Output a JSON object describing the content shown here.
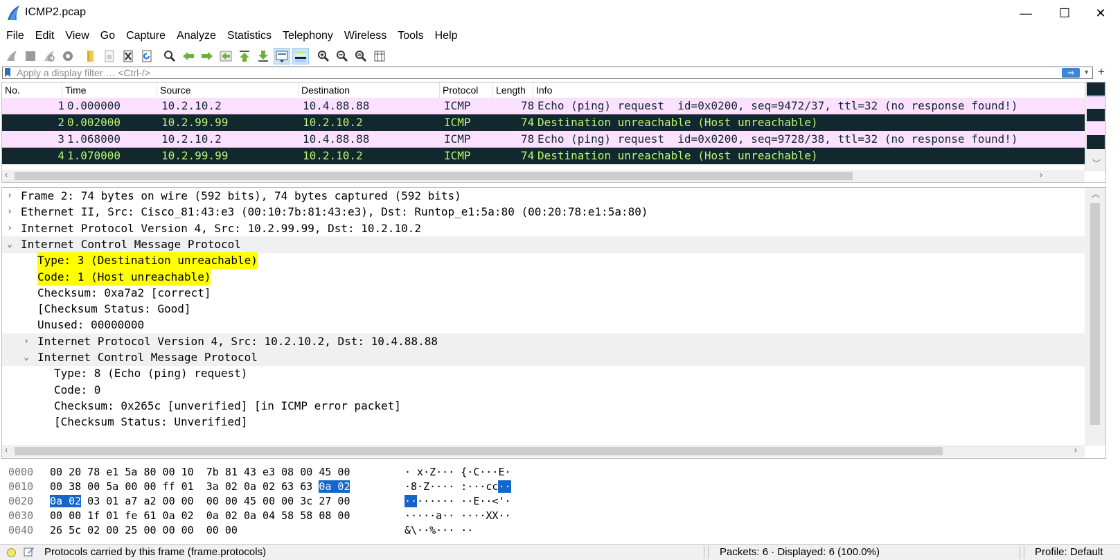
{
  "window": {
    "title": "ICMP2.pcap",
    "minimize": "—",
    "maximize": "☐",
    "close": "✕"
  },
  "menu": [
    "File",
    "Edit",
    "View",
    "Go",
    "Capture",
    "Analyze",
    "Statistics",
    "Telephony",
    "Wireless",
    "Tools",
    "Help"
  ],
  "toolbar": {
    "icons": [
      "shark-fin-start-icon",
      "stop-capture-icon",
      "restart-capture-icon",
      "capture-options-icon",
      "open-file-icon",
      "save-file-icon",
      "close-file-icon",
      "reload-file-icon",
      "find-packet-icon",
      "go-back-icon",
      "go-forward-icon",
      "go-to-packet-icon",
      "go-first-icon",
      "go-last-icon",
      "autoscroll-icon",
      "colorize-icon",
      "zoom-in-icon",
      "zoom-out-icon",
      "zoom-normal-icon",
      "resize-columns-icon"
    ]
  },
  "filter": {
    "placeholder": "Apply a display filter … <Ctrl-/>",
    "apply_label": "⇒",
    "add_label": "+"
  },
  "packet_list": {
    "columns": [
      "No.",
      "Time",
      "Source",
      "Destination",
      "Protocol",
      "Length",
      "Info"
    ],
    "rows": [
      {
        "no": "1",
        "time": "0.000000",
        "source": "10.2.10.2",
        "destination": "10.4.88.88",
        "protocol": "ICMP",
        "length": "78",
        "info": "Echo (ping) request  id=0x0200, seq=9472/37, ttl=32 (no response found!)",
        "kind": "req"
      },
      {
        "no": "2",
        "time": "0.002000",
        "source": "10.2.99.99",
        "destination": "10.2.10.2",
        "protocol": "ICMP",
        "length": "74",
        "info": "Destination unreachable (Host unreachable)",
        "kind": "err"
      },
      {
        "no": "3",
        "time": "1.068000",
        "source": "10.2.10.2",
        "destination": "10.4.88.88",
        "protocol": "ICMP",
        "length": "78",
        "info": "Echo (ping) request  id=0x0200, seq=9728/38, ttl=32 (no response found!)",
        "kind": "req"
      },
      {
        "no": "4",
        "time": "1.070000",
        "source": "10.2.99.99",
        "destination": "10.2.10.2",
        "protocol": "ICMP",
        "length": "74",
        "info": "Destination unreachable (Host unreachable)",
        "kind": "err"
      }
    ]
  },
  "details": {
    "lines": [
      {
        "indent": 0,
        "arrow": "›",
        "text": "Frame 2: 74 bytes on wire (592 bits), 74 bytes captured (592 bits)",
        "expanded": false,
        "highlight": false
      },
      {
        "indent": 0,
        "arrow": "›",
        "text": "Ethernet II, Src: Cisco_81:43:e3 (00:10:7b:81:43:e3), Dst: Runtop_e1:5a:80 (00:20:78:e1:5a:80)",
        "expanded": false,
        "highlight": false
      },
      {
        "indent": 0,
        "arrow": "›",
        "text": "Internet Protocol Version 4, Src: 10.2.99.99, Dst: 10.2.10.2",
        "expanded": false,
        "highlight": false
      },
      {
        "indent": 0,
        "arrow": "⌄",
        "text": "Internet Control Message Protocol",
        "expanded": true,
        "highlight": false
      },
      {
        "indent": 1,
        "arrow": "",
        "text": "Type: 3 (Destination unreachable)",
        "expanded": false,
        "highlight": true
      },
      {
        "indent": 1,
        "arrow": "",
        "text": "Code: 1 (Host unreachable)",
        "expanded": false,
        "highlight": true
      },
      {
        "indent": 1,
        "arrow": "",
        "text": "Checksum: 0xa7a2 [correct]",
        "expanded": false,
        "highlight": false
      },
      {
        "indent": 1,
        "arrow": "",
        "text": "[Checksum Status: Good]",
        "expanded": false,
        "highlight": false
      },
      {
        "indent": 1,
        "arrow": "",
        "text": "Unused: 00000000",
        "expanded": false,
        "highlight": false
      },
      {
        "indent": 1,
        "arrow": "›",
        "text": "Internet Protocol Version 4, Src: 10.2.10.2, Dst: 10.4.88.88",
        "expanded": true,
        "highlight": false
      },
      {
        "indent": 1,
        "arrow": "⌄",
        "text": "Internet Control Message Protocol",
        "expanded": true,
        "highlight": false
      },
      {
        "indent": 2,
        "arrow": "",
        "text": "Type: 8 (Echo (ping) request)",
        "expanded": false,
        "highlight": false
      },
      {
        "indent": 2,
        "arrow": "",
        "text": "Code: 0",
        "expanded": false,
        "highlight": false
      },
      {
        "indent": 2,
        "arrow": "",
        "text": "Checksum: 0x265c [unverified] [in ICMP error packet]",
        "expanded": false,
        "highlight": false
      },
      {
        "indent": 2,
        "arrow": "",
        "text": "[Checksum Status: Unverified]",
        "expanded": false,
        "highlight": false
      }
    ]
  },
  "bytes": {
    "rows": [
      {
        "offset": "0000",
        "hex": [
          "00 20 78 e1 5a 80 00 10  7b 81 43 e3 08 00 45 00"
        ],
        "ascii": [
          "· x·Z··· {·C···E·"
        ]
      },
      {
        "offset": "0010",
        "hex": [
          "00 38 00 5a 00 00 ff 01  3a 02 0a 02 63 63 ",
          "0a 02"
        ],
        "ascii": [
          "·8·Z···· :···cc",
          "··"
        ]
      },
      {
        "offset": "0020",
        "hex": [
          "",
          "0a 02",
          " 03 01 a7 a2 00 00  00 00 45 00 00 3c 27 00"
        ],
        "ascii": [
          "",
          "··",
          "······ ··E··<'·"
        ]
      },
      {
        "offset": "0030",
        "hex": [
          "00 00 1f 01 fe 61 0a 02  0a 02 0a 04 58 58 08 00"
        ],
        "ascii": [
          "·····a·· ····XX··"
        ]
      },
      {
        "offset": "0040",
        "hex": [
          "26 5c 02 00 25 00 00 00  00 00"
        ],
        "ascii": [
          "&\\··%··· ··"
        ]
      }
    ]
  },
  "status": {
    "text": "Protocols carried by this frame (frame.protocols)",
    "packets": "Packets: 6 · Displayed: 6 (100.0%)",
    "profile": "Profile: Default"
  },
  "colors": {
    "request_bg": "#fce0ff",
    "error_bg": "#12272e",
    "error_fg": "#b7f774",
    "highlight": "#ffff00",
    "byte_selection": "#1466c9"
  }
}
